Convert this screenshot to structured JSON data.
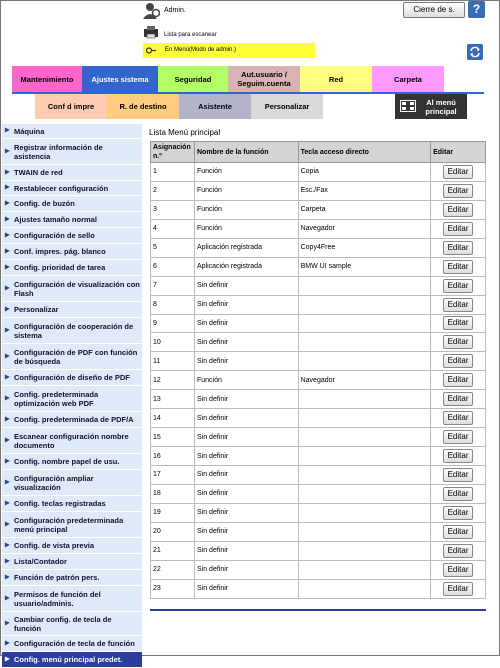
{
  "header": {
    "user": "Admin.",
    "logout_label": "Cierre de s.",
    "help_label": "?",
    "list_label": "Lista para escanear",
    "mode_label": "En Menú(Modo de admin.)"
  },
  "tabs_row1": [
    {
      "label": "Mantenimiento",
      "color": "#ff66cc"
    },
    {
      "label": "Ajustes sistema",
      "color": "#3366cc",
      "active": true
    },
    {
      "label": "Seguridad",
      "color": "#b3ff66"
    },
    {
      "label": "Aut.usuario / Seguim.cuenta",
      "color": "#d9b3b3"
    },
    {
      "label": "Red",
      "color": "#ffff80"
    },
    {
      "label": "Carpeta",
      "color": "#ff99ff"
    }
  ],
  "tabs_row2": [
    {
      "label": "Conf d impre",
      "color": "#ffccb3"
    },
    {
      "label": "R. de destino",
      "color": "#ffcc80"
    },
    {
      "label": "Asistente",
      "color": "#b3b3cc"
    },
    {
      "label": "Personalizar",
      "color": "#d9d9d9"
    },
    {
      "label": "Al menú principal",
      "color": "#333333"
    }
  ],
  "sidebar": [
    "Máquina",
    "Registrar información de asistencia",
    "TWAIN de red",
    "Restablecer configuración",
    "Config. de buzón",
    "Ajustes tamaño normal",
    "Configuración de sello",
    "Conf. impres. pág. blanco",
    "Config. prioridad de tarea",
    "Configuración de visualización con Flash",
    "Personalizar",
    "Configuración de cooperación de sistema",
    "Configuración de PDF con función de búsqueda",
    "Configuración de diseño de PDF",
    "Config. predeterminada optimización web PDF",
    "Config. predeterminada de PDF/A",
    "Escanear configuración nombre documento",
    "Config. nombre papel de usu.",
    "Configuración ampliar visualización",
    "Config. teclas registradas",
    "Configuración predeterminada menú principal",
    "Config. de vista previa",
    "Lista/Contador",
    "Función de patrón pers.",
    "Permisos de función del usuario/adminis.",
    "Cambiar config. de tecla de función",
    "Configuración de tecla de función",
    "Config. menú principal predet."
  ],
  "main": {
    "title": "Lista Menú principal",
    "headers": [
      "Asignación n.º",
      "Nombre de la función",
      "Tecla acceso directo",
      "Editar"
    ],
    "edit_label": "Editar",
    "rows": [
      [
        "1",
        "Función",
        "Copia"
      ],
      [
        "2",
        "Función",
        "Esc./Fax"
      ],
      [
        "3",
        "Función",
        "Carpeta"
      ],
      [
        "4",
        "Función",
        "Navegador"
      ],
      [
        "5",
        "Aplicación registrada",
        "Copy4Free"
      ],
      [
        "6",
        "Aplicación registrada",
        "BMW UI sample"
      ],
      [
        "7",
        "Sin definir",
        ""
      ],
      [
        "8",
        "Sin definir",
        ""
      ],
      [
        "9",
        "Sin definir",
        ""
      ],
      [
        "10",
        "Sin definir",
        ""
      ],
      [
        "11",
        "Sin definir",
        ""
      ],
      [
        "12",
        "Función",
        "Navegador"
      ],
      [
        "13",
        "Sin definir",
        ""
      ],
      [
        "14",
        "Sin definir",
        ""
      ],
      [
        "15",
        "Sin definir",
        ""
      ],
      [
        "16",
        "Sin definir",
        ""
      ],
      [
        "17",
        "Sin definir",
        ""
      ],
      [
        "18",
        "Sin definir",
        ""
      ],
      [
        "19",
        "Sin definir",
        ""
      ],
      [
        "20",
        "Sin definir",
        ""
      ],
      [
        "21",
        "Sin definir",
        ""
      ],
      [
        "22",
        "Sin definir",
        ""
      ],
      [
        "23",
        "Sin definir",
        ""
      ]
    ]
  }
}
